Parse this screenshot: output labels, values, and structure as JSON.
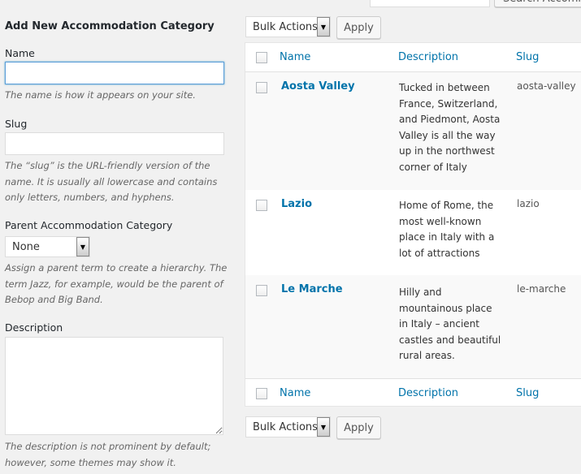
{
  "form": {
    "title": "Add New Accommodation Category",
    "name_label": "Name",
    "name_value": "",
    "name_hint": "The name is how it appears on your site.",
    "slug_label": "Slug",
    "slug_value": "",
    "slug_hint": "The “slug” is the URL-friendly version of the name. It is usually all lowercase and contains only letters, numbers, and hyphens.",
    "parent_label": "Parent Accommodation Category",
    "parent_value": "None",
    "parent_hint": "Assign a parent term to create a hierarchy. The term Jazz, for example, would be the parent of Bebop and Big Band.",
    "description_label": "Description",
    "description_value": "",
    "description_hint": "The description is not prominent by default; however, some themes may show it."
  },
  "search": {
    "button_label": "Search Accommo"
  },
  "bulk": {
    "select_value": "Bulk Actions",
    "apply_label": "Apply"
  },
  "table": {
    "columns": [
      "Name",
      "Description",
      "Slug"
    ],
    "rows": [
      {
        "name": "Aosta Valley",
        "description": "Tucked in between France, Switzerland, and Piedmont, Aosta Valley is all the way up in the northwest corner of Italy",
        "slug": "aosta-valley"
      },
      {
        "name": "Lazio",
        "description": "Home of Rome, the most well-known place in Italy with a lot of attractions",
        "slug": "lazio"
      },
      {
        "name": "Le Marche",
        "description": "Hilly and mountainous place in Italy – ancient castles and beautiful rural areas.",
        "slug": "le-marche"
      }
    ]
  }
}
